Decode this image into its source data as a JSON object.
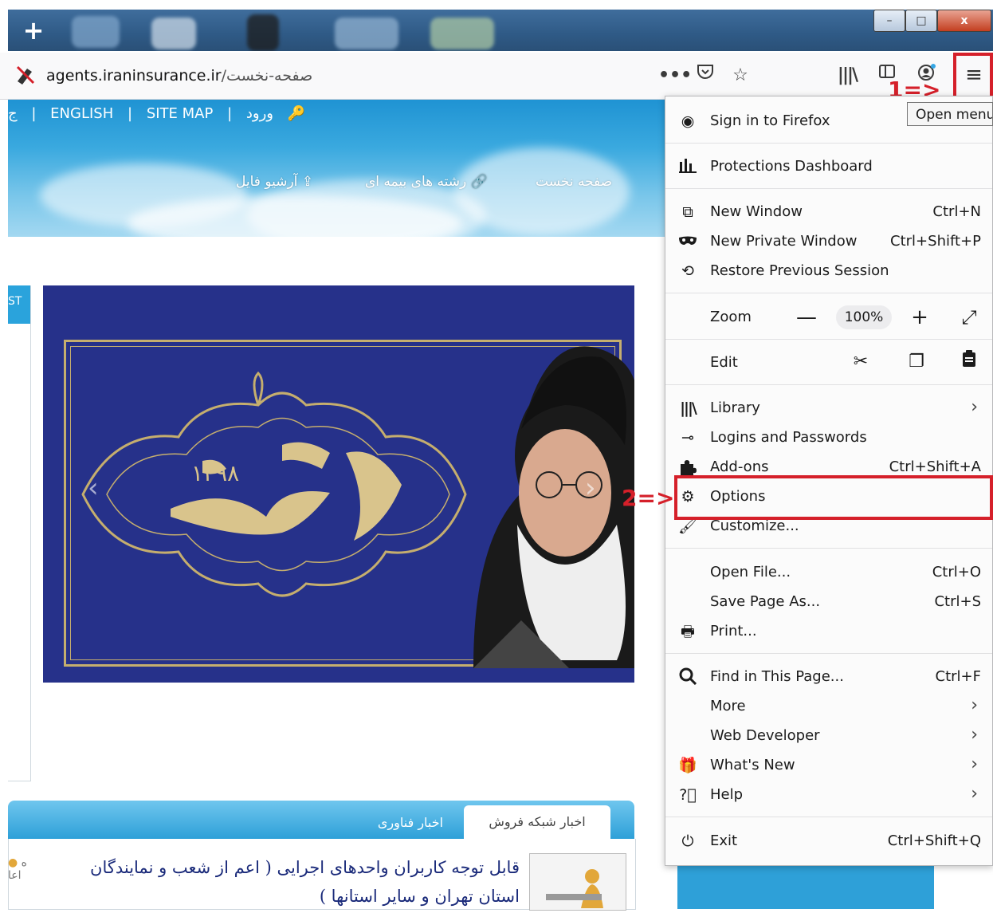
{
  "browser": {
    "new_tab_symbol": "+",
    "window_controls": {
      "minimize": "–",
      "maximize": "□",
      "close": "x"
    },
    "url": {
      "host": "agents.iraninsurance.ir",
      "path": "/صفحه-نخست"
    },
    "tooltip": "Open menu",
    "icons": [
      "insecure-lock-icon",
      "page-actions-icon",
      "pocket-icon",
      "bookmark-star-icon",
      "library-icon",
      "sidebar-icon",
      "account-icon",
      "hamburger-menu-icon"
    ]
  },
  "annotations": {
    "step1": "1=>",
    "step2": "2=>"
  },
  "site": {
    "top_links": [
      "ج",
      "|",
      "ENGLISH",
      "|",
      "SITE MAP",
      "|",
      "ورود"
    ],
    "main_nav": [
      "صفحه نخست",
      "رشته های بیمه ای",
      "آرشیو فایل"
    ],
    "side_tab": "ST",
    "news_tabs": [
      "اخبار شبکه فروش",
      "اخبار فناوری"
    ],
    "news_headline": "قابل توجه کاربران واحدهای اجرایی ( اعم از شعب و نمایندگان استان تهران و سایر استانها )",
    "left_fragment": [
      "ه",
      "اعا"
    ]
  },
  "menu": {
    "sign_in": "Sign in to Firefox",
    "protections": "Protections Dashboard",
    "new_window": {
      "label": "New Window",
      "shortcut": "Ctrl+N"
    },
    "new_private": {
      "label": "New Private Window",
      "shortcut": "Ctrl+Shift+P"
    },
    "restore": "Restore Previous Session",
    "zoom": {
      "label": "Zoom",
      "minus": "—",
      "value": "100%",
      "plus": "+",
      "fullscreen": "⤢"
    },
    "edit": {
      "label": "Edit"
    },
    "library": "Library",
    "logins": "Logins and Passwords",
    "addons": {
      "label": "Add-ons",
      "shortcut": "Ctrl+Shift+A"
    },
    "options": "Options",
    "customize": "Customize...",
    "open_file": {
      "label": "Open File...",
      "shortcut": "Ctrl+O"
    },
    "save_page": {
      "label": "Save Page As...",
      "shortcut": "Ctrl+S"
    },
    "print": "Print...",
    "find": {
      "label": "Find in This Page...",
      "shortcut": "Ctrl+F"
    },
    "more": "More",
    "web_dev": "Web Developer",
    "whats_new": "What's New",
    "help": "Help",
    "exit": {
      "label": "Exit",
      "shortcut": "Ctrl+Shift+Q"
    }
  }
}
